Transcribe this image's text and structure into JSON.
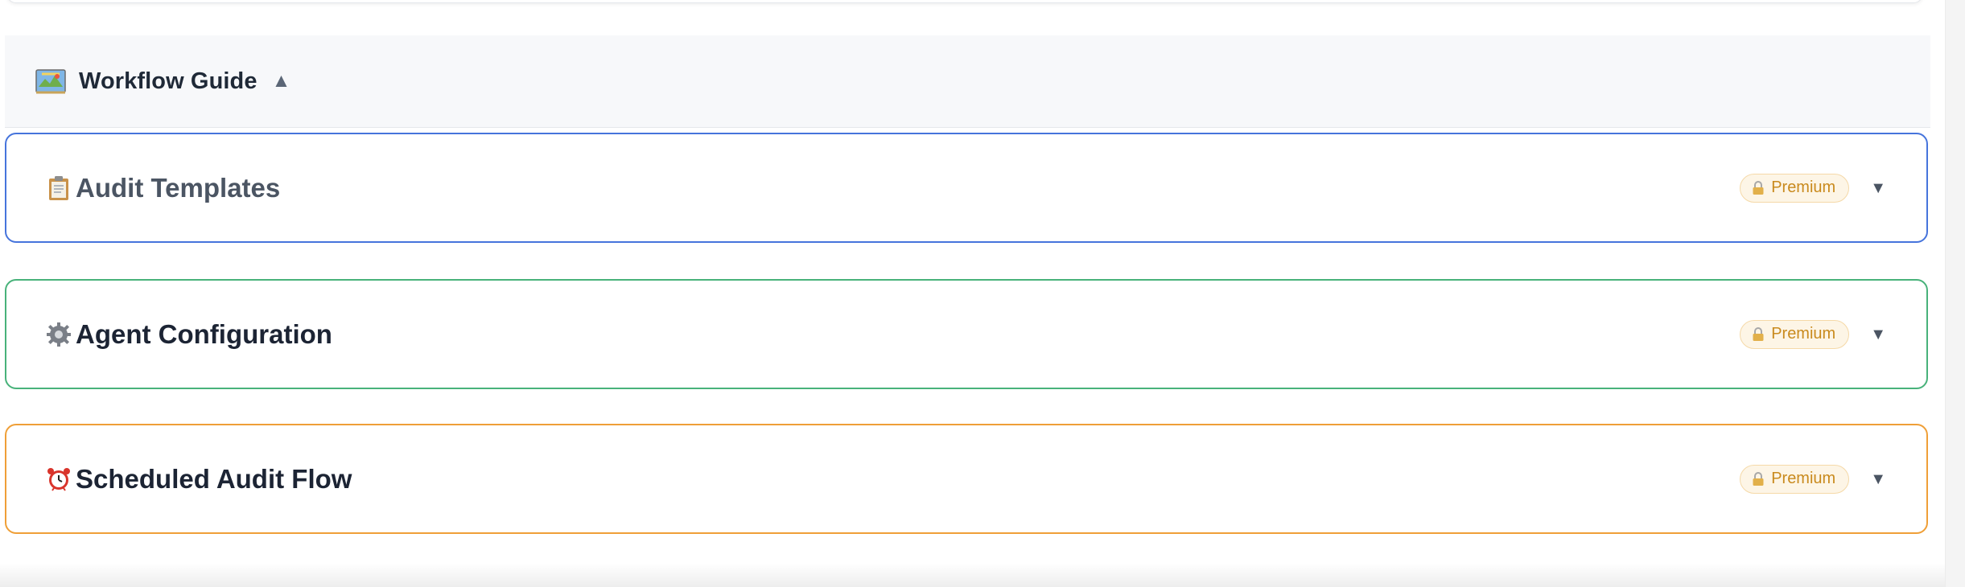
{
  "guide": {
    "title": "Workflow Guide",
    "toggle": "▲",
    "icon": "map-icon"
  },
  "cards": [
    {
      "title": "Audit Templates",
      "icon": "clipboard-icon",
      "badge": "Premium",
      "chevron": "▼",
      "accent": "#4674dc"
    },
    {
      "title": "Agent Configuration",
      "icon": "gear-icon",
      "badge": "Premium",
      "chevron": "▼",
      "accent": "#48b27a"
    },
    {
      "title": "Scheduled Audit Flow",
      "icon": "alarm-clock-icon",
      "badge": "Premium",
      "chevron": "▼",
      "accent": "#ef9f37"
    }
  ],
  "colors": {
    "badge_bg": "#fdf5e6",
    "badge_text": "#c98a1d"
  }
}
